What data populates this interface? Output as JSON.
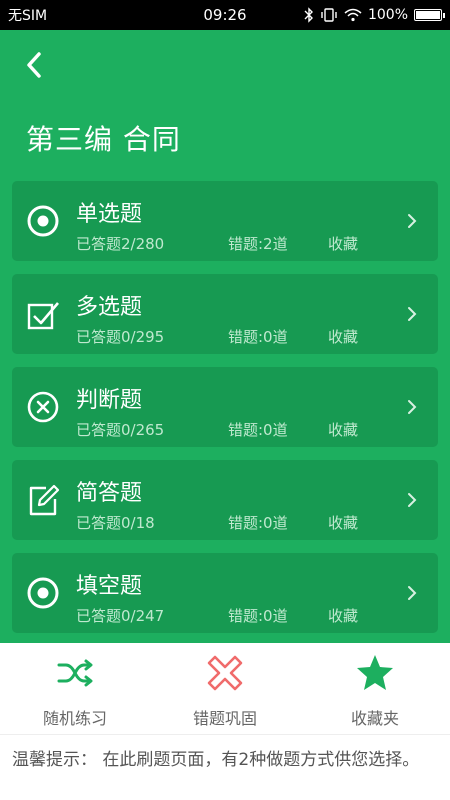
{
  "status_bar": {
    "carrier": "无SIM",
    "time": "09:26",
    "battery": "100%",
    "battery_level": 1.0
  },
  "header": {
    "title": "第三编 合同"
  },
  "categories": [
    {
      "title": "单选题",
      "answered": "已答题2/280",
      "wrong": "错题:2道",
      "favorite": "收藏",
      "icon": "radio-target-icon"
    },
    {
      "title": "多选题",
      "answered": "已答题0/295",
      "wrong": "错题:0道",
      "favorite": "收藏",
      "icon": "checkbox-icon"
    },
    {
      "title": "判断题",
      "answered": "已答题0/265",
      "wrong": "错题:0道",
      "favorite": "收藏",
      "icon": "circle-x-icon"
    },
    {
      "title": "简答题",
      "answered": "已答题0/18",
      "wrong": "错题:0道",
      "favorite": "收藏",
      "icon": "edit-icon"
    },
    {
      "title": "填空题",
      "answered": "已答题0/247",
      "wrong": "错题:0道",
      "favorite": "收藏",
      "icon": "radio-target-icon"
    }
  ],
  "bottom_tabs": [
    {
      "label": "随机练习",
      "icon": "shuffle-icon",
      "color": "#1daf5f"
    },
    {
      "label": "错题巩固",
      "icon": "cross-icon",
      "color": "#f06b6b"
    },
    {
      "label": "收藏夹",
      "icon": "star-icon",
      "color": "#1daf5f"
    }
  ],
  "tip": {
    "text": "温馨提示： 在此刷题页面，有2种做题方式供您选择。"
  },
  "colors": {
    "primary_green": "#1daf5f",
    "card_green": "#179a52",
    "error_red": "#f06b6b"
  }
}
